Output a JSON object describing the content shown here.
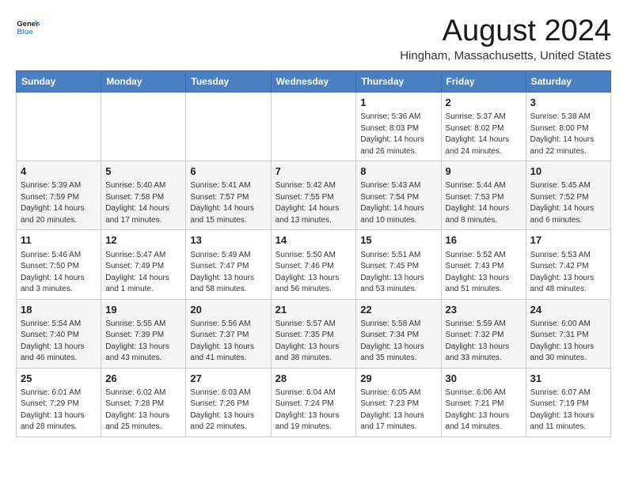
{
  "logo": {
    "line1": "General",
    "line2": "Blue"
  },
  "title": "August 2024",
  "location": "Hingham, Massachusetts, United States",
  "days_of_week": [
    "Sunday",
    "Monday",
    "Tuesday",
    "Wednesday",
    "Thursday",
    "Friday",
    "Saturday"
  ],
  "weeks": [
    [
      {
        "day": "",
        "info": ""
      },
      {
        "day": "",
        "info": ""
      },
      {
        "day": "",
        "info": ""
      },
      {
        "day": "",
        "info": ""
      },
      {
        "day": "1",
        "info": "Sunrise: 5:36 AM\nSunset: 8:03 PM\nDaylight: 14 hours\nand 26 minutes."
      },
      {
        "day": "2",
        "info": "Sunrise: 5:37 AM\nSunset: 8:02 PM\nDaylight: 14 hours\nand 24 minutes."
      },
      {
        "day": "3",
        "info": "Sunrise: 5:38 AM\nSunset: 8:00 PM\nDaylight: 14 hours\nand 22 minutes."
      }
    ],
    [
      {
        "day": "4",
        "info": "Sunrise: 5:39 AM\nSunset: 7:59 PM\nDaylight: 14 hours\nand 20 minutes."
      },
      {
        "day": "5",
        "info": "Sunrise: 5:40 AM\nSunset: 7:58 PM\nDaylight: 14 hours\nand 17 minutes."
      },
      {
        "day": "6",
        "info": "Sunrise: 5:41 AM\nSunset: 7:57 PM\nDaylight: 14 hours\nand 15 minutes."
      },
      {
        "day": "7",
        "info": "Sunrise: 5:42 AM\nSunset: 7:55 PM\nDaylight: 14 hours\nand 13 minutes."
      },
      {
        "day": "8",
        "info": "Sunrise: 5:43 AM\nSunset: 7:54 PM\nDaylight: 14 hours\nand 10 minutes."
      },
      {
        "day": "9",
        "info": "Sunrise: 5:44 AM\nSunset: 7:53 PM\nDaylight: 14 hours\nand 8 minutes."
      },
      {
        "day": "10",
        "info": "Sunrise: 5:45 AM\nSunset: 7:52 PM\nDaylight: 14 hours\nand 6 minutes."
      }
    ],
    [
      {
        "day": "11",
        "info": "Sunrise: 5:46 AM\nSunset: 7:50 PM\nDaylight: 14 hours\nand 3 minutes."
      },
      {
        "day": "12",
        "info": "Sunrise: 5:47 AM\nSunset: 7:49 PM\nDaylight: 14 hours\nand 1 minute."
      },
      {
        "day": "13",
        "info": "Sunrise: 5:49 AM\nSunset: 7:47 PM\nDaylight: 13 hours\nand 58 minutes."
      },
      {
        "day": "14",
        "info": "Sunrise: 5:50 AM\nSunset: 7:46 PM\nDaylight: 13 hours\nand 56 minutes."
      },
      {
        "day": "15",
        "info": "Sunrise: 5:51 AM\nSunset: 7:45 PM\nDaylight: 13 hours\nand 53 minutes."
      },
      {
        "day": "16",
        "info": "Sunrise: 5:52 AM\nSunset: 7:43 PM\nDaylight: 13 hours\nand 51 minutes."
      },
      {
        "day": "17",
        "info": "Sunrise: 5:53 AM\nSunset: 7:42 PM\nDaylight: 13 hours\nand 48 minutes."
      }
    ],
    [
      {
        "day": "18",
        "info": "Sunrise: 5:54 AM\nSunset: 7:40 PM\nDaylight: 13 hours\nand 46 minutes."
      },
      {
        "day": "19",
        "info": "Sunrise: 5:55 AM\nSunset: 7:39 PM\nDaylight: 13 hours\nand 43 minutes."
      },
      {
        "day": "20",
        "info": "Sunrise: 5:56 AM\nSunset: 7:37 PM\nDaylight: 13 hours\nand 41 minutes."
      },
      {
        "day": "21",
        "info": "Sunrise: 5:57 AM\nSunset: 7:35 PM\nDaylight: 13 hours\nand 38 minutes."
      },
      {
        "day": "22",
        "info": "Sunrise: 5:58 AM\nSunset: 7:34 PM\nDaylight: 13 hours\nand 35 minutes."
      },
      {
        "day": "23",
        "info": "Sunrise: 5:59 AM\nSunset: 7:32 PM\nDaylight: 13 hours\nand 33 minutes."
      },
      {
        "day": "24",
        "info": "Sunrise: 6:00 AM\nSunset: 7:31 PM\nDaylight: 13 hours\nand 30 minutes."
      }
    ],
    [
      {
        "day": "25",
        "info": "Sunrise: 6:01 AM\nSunset: 7:29 PM\nDaylight: 13 hours\nand 28 minutes."
      },
      {
        "day": "26",
        "info": "Sunrise: 6:02 AM\nSunset: 7:28 PM\nDaylight: 13 hours\nand 25 minutes."
      },
      {
        "day": "27",
        "info": "Sunrise: 6:03 AM\nSunset: 7:26 PM\nDaylight: 13 hours\nand 22 minutes."
      },
      {
        "day": "28",
        "info": "Sunrise: 6:04 AM\nSunset: 7:24 PM\nDaylight: 13 hours\nand 19 minutes."
      },
      {
        "day": "29",
        "info": "Sunrise: 6:05 AM\nSunset: 7:23 PM\nDaylight: 13 hours\nand 17 minutes."
      },
      {
        "day": "30",
        "info": "Sunrise: 6:06 AM\nSunset: 7:21 PM\nDaylight: 13 hours\nand 14 minutes."
      },
      {
        "day": "31",
        "info": "Sunrise: 6:07 AM\nSunset: 7:19 PM\nDaylight: 13 hours\nand 11 minutes."
      }
    ]
  ]
}
